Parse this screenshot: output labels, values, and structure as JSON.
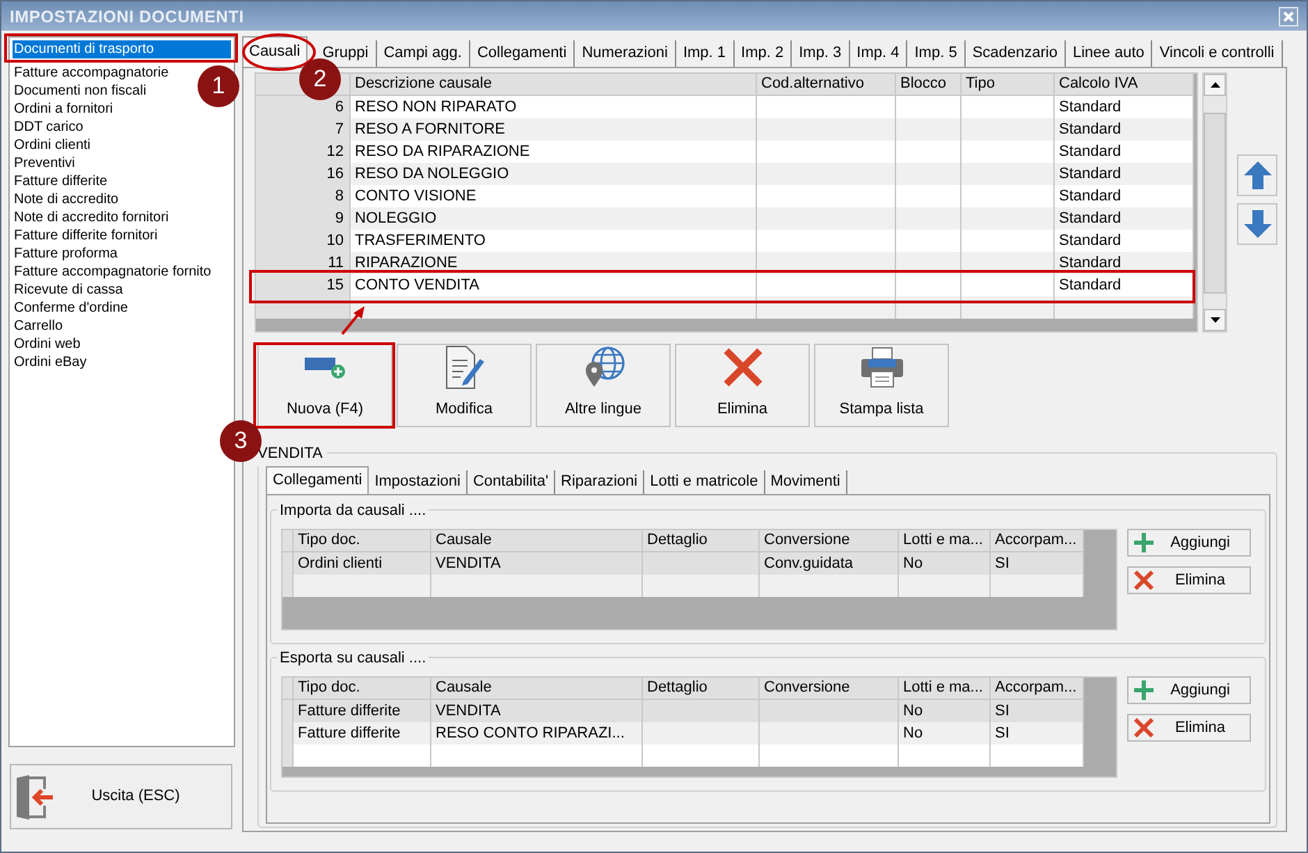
{
  "window": {
    "title": "IMPOSTAZIONI DOCUMENTI"
  },
  "document_types": [
    {
      "label": "Documenti di trasporto",
      "selected": true
    },
    {
      "label": "Fatture accompagnatorie",
      "selected": false
    },
    {
      "label": "Documenti non fiscali",
      "selected": false
    },
    {
      "label": "Ordini a fornitori",
      "selected": false
    },
    {
      "label": "DDT carico",
      "selected": false
    },
    {
      "label": "Ordini clienti",
      "selected": false
    },
    {
      "label": "Preventivi",
      "selected": false
    },
    {
      "label": "Fatture differite",
      "selected": false
    },
    {
      "label": "Note di accredito",
      "selected": false
    },
    {
      "label": "Note di accredito fornitori",
      "selected": false
    },
    {
      "label": "Fatture differite fornitori",
      "selected": false
    },
    {
      "label": "Fatture proforma",
      "selected": false
    },
    {
      "label": "Fatture accompagnatorie fornito",
      "selected": false
    },
    {
      "label": "Ricevute di cassa",
      "selected": false
    },
    {
      "label": "Conferme d'ordine",
      "selected": false
    },
    {
      "label": "Carrello",
      "selected": false
    },
    {
      "label": "Ordini web",
      "selected": false
    },
    {
      "label": "Ordini eBay",
      "selected": false
    }
  ],
  "exit_button": {
    "label": "Uscita (ESC)"
  },
  "tabs": [
    {
      "label": "Causali",
      "selected": true
    },
    {
      "label": "Gruppi",
      "selected": false
    },
    {
      "label": "Campi agg.",
      "selected": false
    },
    {
      "label": "Collegamenti",
      "selected": false
    },
    {
      "label": "Numerazioni",
      "selected": false
    },
    {
      "label": "Imp. 1",
      "selected": false
    },
    {
      "label": "Imp. 2",
      "selected": false
    },
    {
      "label": "Imp. 3",
      "selected": false
    },
    {
      "label": "Imp. 4",
      "selected": false
    },
    {
      "label": "Imp. 5",
      "selected": false
    },
    {
      "label": "Scadenzario",
      "selected": false
    },
    {
      "label": "Linee auto",
      "selected": false
    },
    {
      "label": "Vincoli e controlli",
      "selected": false
    }
  ],
  "causali_table": {
    "columns": [
      "Descrizione causale",
      "Cod.alternativo",
      "Blocco",
      "Tipo",
      "Calcolo IVA"
    ],
    "rows": [
      {
        "code": "6",
        "cells": [
          "RESO NON RIPARATO",
          "",
          "",
          "",
          "Standard"
        ]
      },
      {
        "code": "7",
        "cells": [
          "RESO A FORNITORE",
          "",
          "",
          "",
          "Standard"
        ]
      },
      {
        "code": "12",
        "cells": [
          "RESO DA RIPARAZIONE",
          "",
          "",
          "",
          "Standard"
        ]
      },
      {
        "code": "16",
        "cells": [
          "RESO DA NOLEGGIO",
          "",
          "",
          "",
          "Standard"
        ]
      },
      {
        "code": "8",
        "cells": [
          "CONTO VISIONE",
          "",
          "",
          "",
          "Standard"
        ]
      },
      {
        "code": "9",
        "cells": [
          "NOLEGGIO",
          "",
          "",
          "",
          "Standard"
        ]
      },
      {
        "code": "10",
        "cells": [
          "TRASFERIMENTO",
          "",
          "",
          "",
          "Standard"
        ]
      },
      {
        "code": "11",
        "cells": [
          "RIPARAZIONE",
          "",
          "",
          "",
          "Standard"
        ]
      },
      {
        "code": "15",
        "cells": [
          "CONTO VENDITA",
          "",
          "",
          "",
          "Standard"
        ]
      }
    ]
  },
  "actions": [
    {
      "label": "Nuova (F4)",
      "kind": "new"
    },
    {
      "label": "Modifica",
      "kind": "edit"
    },
    {
      "label": "Altre lingue",
      "kind": "languages"
    },
    {
      "label": "Elimina",
      "kind": "delete"
    },
    {
      "label": "Stampa lista",
      "kind": "print"
    }
  ],
  "detail": {
    "title": "VENDITA",
    "tabs": [
      {
        "label": "Collegamenti",
        "selected": true
      },
      {
        "label": "Impostazioni",
        "selected": false
      },
      {
        "label": "Contabilita'",
        "selected": false
      },
      {
        "label": "Riparazioni",
        "selected": false
      },
      {
        "label": "Lotti e matricole",
        "selected": false
      },
      {
        "label": "Movimenti",
        "selected": false
      }
    ],
    "groups": [
      {
        "title": "Importa da causali ....",
        "columns": [
          "Tipo doc.",
          "Causale",
          "Dettaglio",
          "Conversione",
          "Lotti e ma...",
          "Accorpam..."
        ],
        "rows": [
          [
            "Ordini clienti",
            "VENDITA",
            "",
            "Conv.guidata",
            "No",
            "SI"
          ]
        ],
        "buttons": [
          {
            "label": "Aggiungi",
            "kind": "add"
          },
          {
            "label": "Elimina",
            "kind": "delete"
          }
        ]
      },
      {
        "title": "Esporta su causali ....",
        "columns": [
          "Tipo doc.",
          "Causale",
          "Dettaglio",
          "Conversione",
          "Lotti e ma...",
          "Accorpam..."
        ],
        "rows": [
          [
            "Fatture differite",
            "VENDITA",
            "",
            "",
            "No",
            "SI"
          ],
          [
            "Fatture differite",
            "RESO CONTO RIPARAZI...",
            "",
            "",
            "No",
            "SI"
          ]
        ],
        "buttons": [
          {
            "label": "Aggiungi",
            "kind": "add"
          },
          {
            "label": "Elimina",
            "kind": "delete"
          }
        ]
      }
    ]
  },
  "annotations": [
    {
      "label": "1"
    },
    {
      "label": "2"
    },
    {
      "label": "3"
    }
  ]
}
